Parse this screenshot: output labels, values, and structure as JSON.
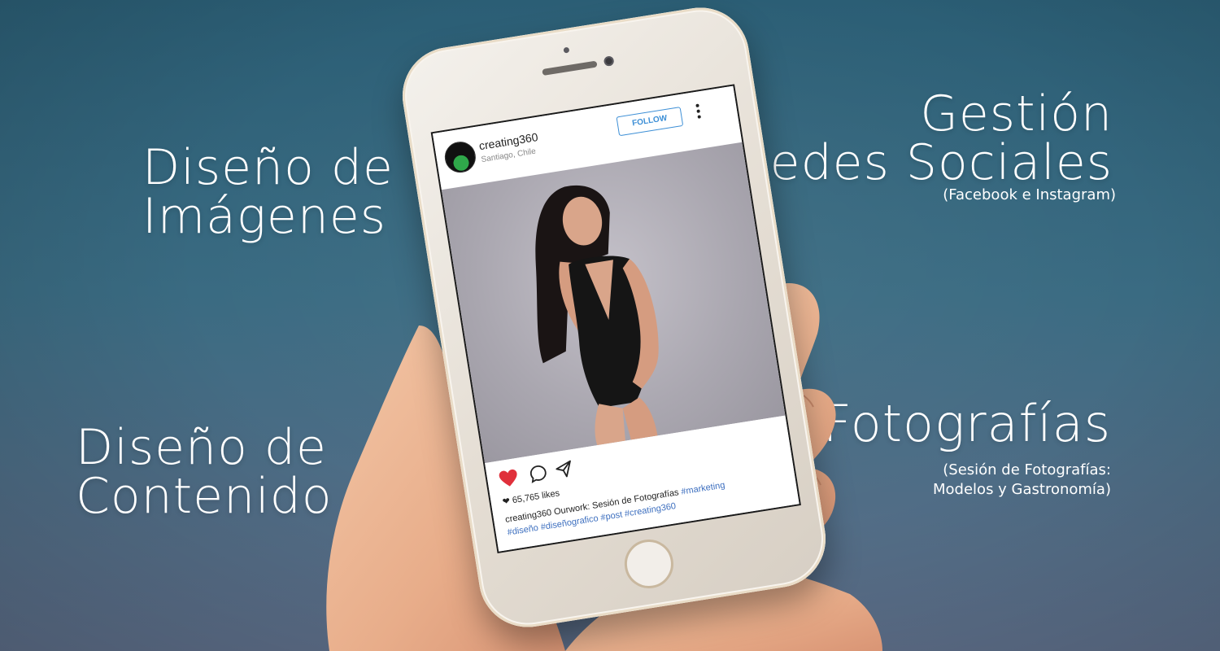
{
  "headlines": {
    "imagenes": {
      "line1": "Diseño de",
      "line2": "Imágenes"
    },
    "contenido": {
      "line1": "Diseño de",
      "line2": "Contenido"
    },
    "redes": {
      "line1": "Gestión",
      "line2": "Redes Sociales",
      "sub": "(Facebook e Instagram)"
    },
    "fotografias": {
      "line1": "Fotografías",
      "sub1": "(Sesión de Fotografías:",
      "sub2": "Modelos y Gastronomía)"
    }
  },
  "post": {
    "username": "creating360",
    "location": "Santiago, Chile",
    "follow_label": "FOLLOW",
    "likes": "65,765 likes",
    "caption_user": "creating360",
    "caption_text": "Ourwork: Sesión de Fotografías",
    "hashtags_line1": "#marketing",
    "hashtags_line2": "#diseño #diseñografico #post #creating360"
  },
  "colors": {
    "background_top": "#2b5e75",
    "background_bottom": "#5e6f8a",
    "follow_blue": "#3d8fd6",
    "hashtag_blue": "#3d6fbf",
    "like_red": "#e0303b",
    "phone_gold": "#e4ddd3"
  },
  "icons": {
    "heart": "heart-icon",
    "comment": "comment-icon",
    "share": "share-icon",
    "bookmark": "bookmark-icon",
    "more": "more-options-icon"
  }
}
